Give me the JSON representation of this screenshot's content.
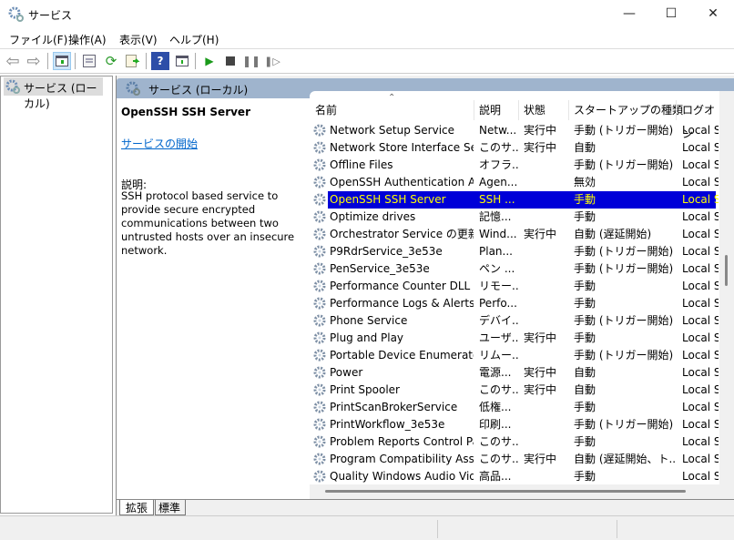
{
  "window": {
    "title": "サービス"
  },
  "menu": [
    "ファイル(F)",
    "操作(A)",
    "表示(V)",
    "ヘルプ(H)"
  ],
  "toolbar": [
    "back",
    "forward",
    "show-hide-console-tree",
    "properties",
    "refresh",
    "export-list",
    "help",
    "action-pane",
    "start",
    "stop",
    "pause",
    "resume"
  ],
  "tree": {
    "item": "サービス (ローカル)"
  },
  "band": {
    "title": "サービス (ローカル)"
  },
  "details": {
    "name": "OpenSSH SSH Server",
    "start_link": "サービスの開始",
    "desc_label": "説明:",
    "desc": "SSH protocol based service to provide secure encrypted communications between two untrusted hosts over an insecure network."
  },
  "columns": [
    "名前",
    "説明",
    "状態",
    "スタートアップの種類",
    "ログオン"
  ],
  "rows": [
    [
      "Network Setup Service",
      "Netw...",
      "実行中",
      "手動 (トリガー開始)",
      "Local S"
    ],
    [
      "Network Store Interface Ser...",
      "このサ...",
      "実行中",
      "自動",
      "Local S"
    ],
    [
      "Offline Files",
      "オフラ...",
      "",
      "手動 (トリガー開始)",
      "Local S"
    ],
    [
      "OpenSSH Authentication A...",
      "Agen...",
      "",
      "無効",
      "Local S"
    ],
    [
      "OpenSSH SSH Server",
      "SSH ...",
      "",
      "手動",
      "Local S"
    ],
    [
      "Optimize drives",
      "記憶...",
      "",
      "手動",
      "Local S"
    ],
    [
      "Orchestrator Service の更新",
      "Wind...",
      "実行中",
      "自動 (遅延開始)",
      "Local S"
    ],
    [
      "P9RdrService_3e53e",
      "Plan...",
      "",
      "手動 (トリガー開始)",
      "Local S"
    ],
    [
      "PenService_3e53e",
      "ペン ...",
      "",
      "手動 (トリガー開始)",
      "Local S"
    ],
    [
      "Performance Counter DLL H...",
      "リモー...",
      "",
      "手動",
      "Local S"
    ],
    [
      "Performance Logs & Alerts",
      "Perfo...",
      "",
      "手動",
      "Local S"
    ],
    [
      "Phone Service",
      "デバイ...",
      "",
      "手動 (トリガー開始)",
      "Local S"
    ],
    [
      "Plug and Play",
      "ユーザ...",
      "実行中",
      "手動",
      "Local S"
    ],
    [
      "Portable Device Enumerator...",
      "リムー...",
      "",
      "手動 (トリガー開始)",
      "Local S"
    ],
    [
      "Power",
      "電源...",
      "実行中",
      "自動",
      "Local S"
    ],
    [
      "Print Spooler",
      "このサ...",
      "実行中",
      "自動",
      "Local S"
    ],
    [
      "PrintScanBrokerService",
      "低権...",
      "",
      "手動",
      "Local S"
    ],
    [
      "PrintWorkflow_3e53e",
      "印刷...",
      "",
      "手動 (トリガー開始)",
      "Local S"
    ],
    [
      "Problem Reports Control Pa...",
      "このサ...",
      "",
      "手動",
      "Local S"
    ],
    [
      "Program Compatibility Assis...",
      "このサ...",
      "実行中",
      "自動 (遅延開始、ト...",
      "Local S"
    ],
    [
      "Quality Windows Audio Vid...",
      "高品...",
      "",
      "手動",
      "Local S"
    ]
  ],
  "selected_row": 4,
  "tabs": [
    "拡張",
    "標準"
  ],
  "colors": {
    "selection": "#0000d8",
    "selection_text": "#ffff00",
    "band": "#9fb4cd"
  }
}
